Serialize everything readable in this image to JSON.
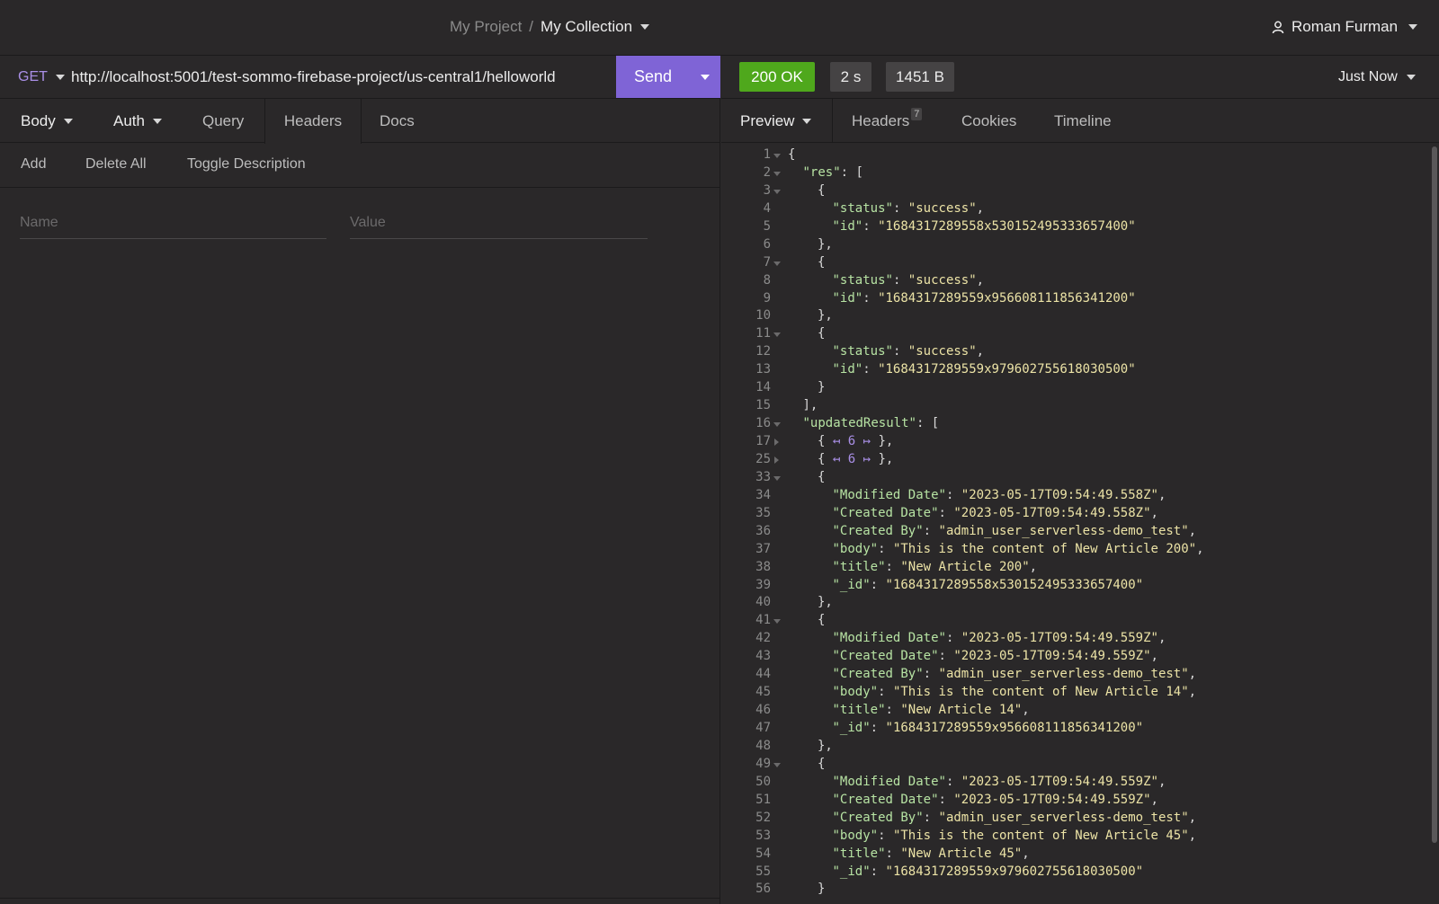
{
  "header": {
    "project": "My Project",
    "separator": "/",
    "collection": "My Collection",
    "user": "Roman Furman"
  },
  "request": {
    "method": "GET",
    "url": "http://localhost:5001/test-sommo-firebase-project/us-central1/helloworld",
    "send_label": "Send",
    "tabs": {
      "body": "Body",
      "auth": "Auth",
      "query": "Query",
      "headers": "Headers",
      "docs": "Docs"
    },
    "actions": {
      "add": "Add",
      "delete_all": "Delete All",
      "toggle_description": "Toggle Description"
    },
    "name_placeholder": "Name",
    "value_placeholder": "Value"
  },
  "response": {
    "status": "200 OK",
    "time": "2 s",
    "size": "1451 B",
    "history": "Just Now",
    "tabs": {
      "preview": "Preview",
      "headers": "Headers",
      "headers_count": "7",
      "cookies": "Cookies",
      "timeline": "Timeline"
    },
    "lines": [
      {
        "n": "1",
        "fold": "open",
        "indent": 0,
        "parts": [
          [
            "p",
            "{"
          ]
        ]
      },
      {
        "n": "2",
        "fold": "open",
        "indent": 1,
        "parts": [
          [
            "k",
            "\"res\""
          ],
          [
            "p",
            ": ["
          ]
        ]
      },
      {
        "n": "3",
        "fold": "open",
        "indent": 2,
        "parts": [
          [
            "p",
            "{"
          ]
        ]
      },
      {
        "n": "4",
        "indent": 3,
        "parts": [
          [
            "k",
            "\"status\""
          ],
          [
            "p",
            ": "
          ],
          [
            "s",
            "\"success\""
          ],
          [
            "p",
            ","
          ]
        ]
      },
      {
        "n": "5",
        "indent": 3,
        "parts": [
          [
            "k",
            "\"id\""
          ],
          [
            "p",
            ": "
          ],
          [
            "s",
            "\"1684317289558x530152495333657400\""
          ]
        ]
      },
      {
        "n": "6",
        "indent": 2,
        "parts": [
          [
            "p",
            "},"
          ]
        ]
      },
      {
        "n": "7",
        "fold": "open",
        "indent": 2,
        "parts": [
          [
            "p",
            "{"
          ]
        ]
      },
      {
        "n": "8",
        "indent": 3,
        "parts": [
          [
            "k",
            "\"status\""
          ],
          [
            "p",
            ": "
          ],
          [
            "s",
            "\"success\""
          ],
          [
            "p",
            ","
          ]
        ]
      },
      {
        "n": "9",
        "indent": 3,
        "parts": [
          [
            "k",
            "\"id\""
          ],
          [
            "p",
            ": "
          ],
          [
            "s",
            "\"1684317289559x956608111856341200\""
          ]
        ]
      },
      {
        "n": "10",
        "indent": 2,
        "parts": [
          [
            "p",
            "},"
          ]
        ]
      },
      {
        "n": "11",
        "fold": "open",
        "indent": 2,
        "parts": [
          [
            "p",
            "{"
          ]
        ]
      },
      {
        "n": "12",
        "indent": 3,
        "parts": [
          [
            "k",
            "\"status\""
          ],
          [
            "p",
            ": "
          ],
          [
            "s",
            "\"success\""
          ],
          [
            "p",
            ","
          ]
        ]
      },
      {
        "n": "13",
        "indent": 3,
        "parts": [
          [
            "k",
            "\"id\""
          ],
          [
            "p",
            ": "
          ],
          [
            "s",
            "\"1684317289559x979602755618030500\""
          ]
        ]
      },
      {
        "n": "14",
        "indent": 2,
        "parts": [
          [
            "p",
            "}"
          ]
        ]
      },
      {
        "n": "15",
        "indent": 1,
        "parts": [
          [
            "p",
            "],"
          ]
        ]
      },
      {
        "n": "16",
        "fold": "open",
        "indent": 1,
        "parts": [
          [
            "k",
            "\"updatedResult\""
          ],
          [
            "p",
            ": ["
          ]
        ]
      },
      {
        "n": "17",
        "fold": "closed",
        "indent": 2,
        "parts": [
          [
            "p",
            "{ "
          ],
          [
            "c",
            "↤ 6 ↦"
          ],
          [
            "p",
            " },"
          ]
        ]
      },
      {
        "n": "25",
        "fold": "closed",
        "indent": 2,
        "parts": [
          [
            "p",
            "{ "
          ],
          [
            "c",
            "↤ 6 ↦"
          ],
          [
            "p",
            " },"
          ]
        ]
      },
      {
        "n": "33",
        "fold": "open",
        "indent": 2,
        "parts": [
          [
            "p",
            "{"
          ]
        ]
      },
      {
        "n": "34",
        "indent": 3,
        "parts": [
          [
            "k",
            "\"Modified Date\""
          ],
          [
            "p",
            ": "
          ],
          [
            "s",
            "\"2023-05-17T09:54:49.558Z\""
          ],
          [
            "p",
            ","
          ]
        ]
      },
      {
        "n": "35",
        "indent": 3,
        "parts": [
          [
            "k",
            "\"Created Date\""
          ],
          [
            "p",
            ": "
          ],
          [
            "s",
            "\"2023-05-17T09:54:49.558Z\""
          ],
          [
            "p",
            ","
          ]
        ]
      },
      {
        "n": "36",
        "indent": 3,
        "parts": [
          [
            "k",
            "\"Created By\""
          ],
          [
            "p",
            ": "
          ],
          [
            "s",
            "\"admin_user_serverless-demo_test\""
          ],
          [
            "p",
            ","
          ]
        ]
      },
      {
        "n": "37",
        "indent": 3,
        "parts": [
          [
            "k",
            "\"body\""
          ],
          [
            "p",
            ": "
          ],
          [
            "s",
            "\"This is the content of New Article 200\""
          ],
          [
            "p",
            ","
          ]
        ]
      },
      {
        "n": "38",
        "indent": 3,
        "parts": [
          [
            "k",
            "\"title\""
          ],
          [
            "p",
            ": "
          ],
          [
            "s",
            "\"New Article 200\""
          ],
          [
            "p",
            ","
          ]
        ]
      },
      {
        "n": "39",
        "indent": 3,
        "parts": [
          [
            "k",
            "\"_id\""
          ],
          [
            "p",
            ": "
          ],
          [
            "s",
            "\"1684317289558x530152495333657400\""
          ]
        ]
      },
      {
        "n": "40",
        "indent": 2,
        "parts": [
          [
            "p",
            "},"
          ]
        ]
      },
      {
        "n": "41",
        "fold": "open",
        "indent": 2,
        "parts": [
          [
            "p",
            "{"
          ]
        ]
      },
      {
        "n": "42",
        "indent": 3,
        "parts": [
          [
            "k",
            "\"Modified Date\""
          ],
          [
            "p",
            ": "
          ],
          [
            "s",
            "\"2023-05-17T09:54:49.559Z\""
          ],
          [
            "p",
            ","
          ]
        ]
      },
      {
        "n": "43",
        "indent": 3,
        "parts": [
          [
            "k",
            "\"Created Date\""
          ],
          [
            "p",
            ": "
          ],
          [
            "s",
            "\"2023-05-17T09:54:49.559Z\""
          ],
          [
            "p",
            ","
          ]
        ]
      },
      {
        "n": "44",
        "indent": 3,
        "parts": [
          [
            "k",
            "\"Created By\""
          ],
          [
            "p",
            ": "
          ],
          [
            "s",
            "\"admin_user_serverless-demo_test\""
          ],
          [
            "p",
            ","
          ]
        ]
      },
      {
        "n": "45",
        "indent": 3,
        "parts": [
          [
            "k",
            "\"body\""
          ],
          [
            "p",
            ": "
          ],
          [
            "s",
            "\"This is the content of New Article 14\""
          ],
          [
            "p",
            ","
          ]
        ]
      },
      {
        "n": "46",
        "indent": 3,
        "parts": [
          [
            "k",
            "\"title\""
          ],
          [
            "p",
            ": "
          ],
          [
            "s",
            "\"New Article 14\""
          ],
          [
            "p",
            ","
          ]
        ]
      },
      {
        "n": "47",
        "indent": 3,
        "parts": [
          [
            "k",
            "\"_id\""
          ],
          [
            "p",
            ": "
          ],
          [
            "s",
            "\"1684317289559x956608111856341200\""
          ]
        ]
      },
      {
        "n": "48",
        "indent": 2,
        "parts": [
          [
            "p",
            "},"
          ]
        ]
      },
      {
        "n": "49",
        "fold": "open",
        "indent": 2,
        "parts": [
          [
            "p",
            "{"
          ]
        ]
      },
      {
        "n": "50",
        "indent": 3,
        "parts": [
          [
            "k",
            "\"Modified Date\""
          ],
          [
            "p",
            ": "
          ],
          [
            "s",
            "\"2023-05-17T09:54:49.559Z\""
          ],
          [
            "p",
            ","
          ]
        ]
      },
      {
        "n": "51",
        "indent": 3,
        "parts": [
          [
            "k",
            "\"Created Date\""
          ],
          [
            "p",
            ": "
          ],
          [
            "s",
            "\"2023-05-17T09:54:49.559Z\""
          ],
          [
            "p",
            ","
          ]
        ]
      },
      {
        "n": "52",
        "indent": 3,
        "parts": [
          [
            "k",
            "\"Created By\""
          ],
          [
            "p",
            ": "
          ],
          [
            "s",
            "\"admin_user_serverless-demo_test\""
          ],
          [
            "p",
            ","
          ]
        ]
      },
      {
        "n": "53",
        "indent": 3,
        "parts": [
          [
            "k",
            "\"body\""
          ],
          [
            "p",
            ": "
          ],
          [
            "s",
            "\"This is the content of New Article 45\""
          ],
          [
            "p",
            ","
          ]
        ]
      },
      {
        "n": "54",
        "indent": 3,
        "parts": [
          [
            "k",
            "\"title\""
          ],
          [
            "p",
            ": "
          ],
          [
            "s",
            "\"New Article 45\""
          ],
          [
            "p",
            ","
          ]
        ]
      },
      {
        "n": "55",
        "indent": 3,
        "parts": [
          [
            "k",
            "\"_id\""
          ],
          [
            "p",
            ": "
          ],
          [
            "s",
            "\"1684317289559x979602755618030500\""
          ]
        ]
      },
      {
        "n": "56",
        "indent": 2,
        "parts": [
          [
            "p",
            "}"
          ]
        ]
      }
    ]
  },
  "icons": {
    "user": "user-icon",
    "dropdown": "chevron-down-icon",
    "fold_open": "fold-open-icon",
    "fold_closed": "fold-closed-icon"
  }
}
